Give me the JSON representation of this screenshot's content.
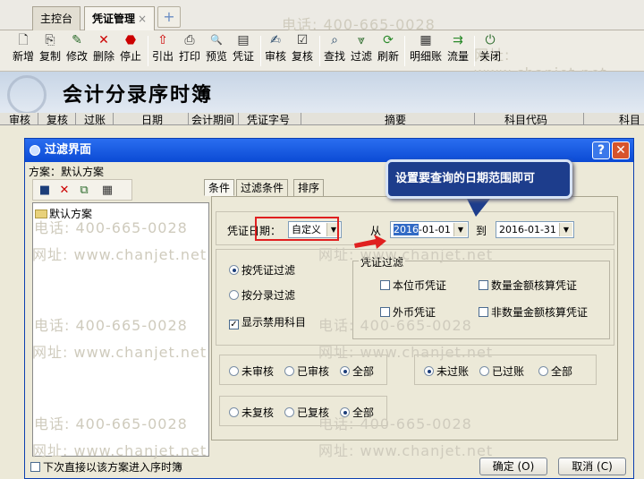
{
  "tabs": [
    {
      "label": "主控台"
    },
    {
      "label": "凭证管理",
      "close": "×"
    }
  ],
  "tab_add": "+",
  "watermarks": {
    "phone": "电话: 400-665-0028",
    "site": "网址: www.chanjet.net"
  },
  "toolbar": [
    {
      "label": "新增",
      "icon": "🗋"
    },
    {
      "label": "复制",
      "icon": "⎘"
    },
    {
      "label": "修改",
      "icon": "✎"
    },
    {
      "label": "删除",
      "icon": "✕"
    },
    {
      "label": "停止",
      "icon": "⬣"
    },
    {
      "label": "引出",
      "icon": "⇧"
    },
    {
      "label": "打印",
      "icon": "⎙"
    },
    {
      "label": "预览",
      "icon": "🔍"
    },
    {
      "label": "凭证",
      "icon": "▤"
    },
    {
      "label": "审核",
      "icon": "✍"
    },
    {
      "label": "复核",
      "icon": "☑"
    },
    {
      "label": "查找",
      "icon": "⌕"
    },
    {
      "label": "过滤",
      "icon": "⩔"
    },
    {
      "label": "刷新",
      "icon": "⟳"
    },
    {
      "label": "明细账",
      "icon": "▦"
    },
    {
      "label": "流量",
      "icon": "⇉"
    },
    {
      "label": "关闭",
      "icon": "⏻"
    }
  ],
  "banner": {
    "title": "会计分录序时簿"
  },
  "columns": [
    "审核",
    "复核",
    "过账",
    "日期",
    "会计期间",
    "凭证字号",
    "摘要",
    "科目代码",
    "科目"
  ],
  "dialog": {
    "title": "过滤界面",
    "help": "?",
    "close": "✕",
    "scheme_label": "方案：默认方案",
    "tree_items": [
      "默认方案"
    ],
    "tabs": [
      "条件",
      "过滤条件",
      "排序"
    ],
    "date_label": "凭证日期：",
    "date_mode": "自定义",
    "from_label": "从",
    "from_year": "2016",
    "from_rest": "-01-01",
    "to_label": "到",
    "to_date": "2016-01-31",
    "filter_mode": [
      "按凭证过滤",
      "按分录过滤"
    ],
    "show_disabled": "显示禁用科目",
    "voucher_filter": {
      "legend": "凭证过滤",
      "items": [
        "本位币凭证",
        "数量金额核算凭证",
        "外币凭证",
        "非数量金额核算凭证"
      ]
    },
    "audit": [
      "未审核",
      "已审核",
      "全部"
    ],
    "post": [
      "未过账",
      "已过账",
      "全部"
    ],
    "review": [
      "未复核",
      "已复核",
      "全部"
    ],
    "remember": "下次直接以该方案进入序时簿",
    "ok": "确定 (O)",
    "cancel": "取消 (C)"
  },
  "tooltip": "设置要查询的日期范围即可",
  "colors": {
    "dialog_title": "#0b4ad4",
    "tooltip_bg": "#1d3d8c",
    "highlight": "#e02020"
  }
}
